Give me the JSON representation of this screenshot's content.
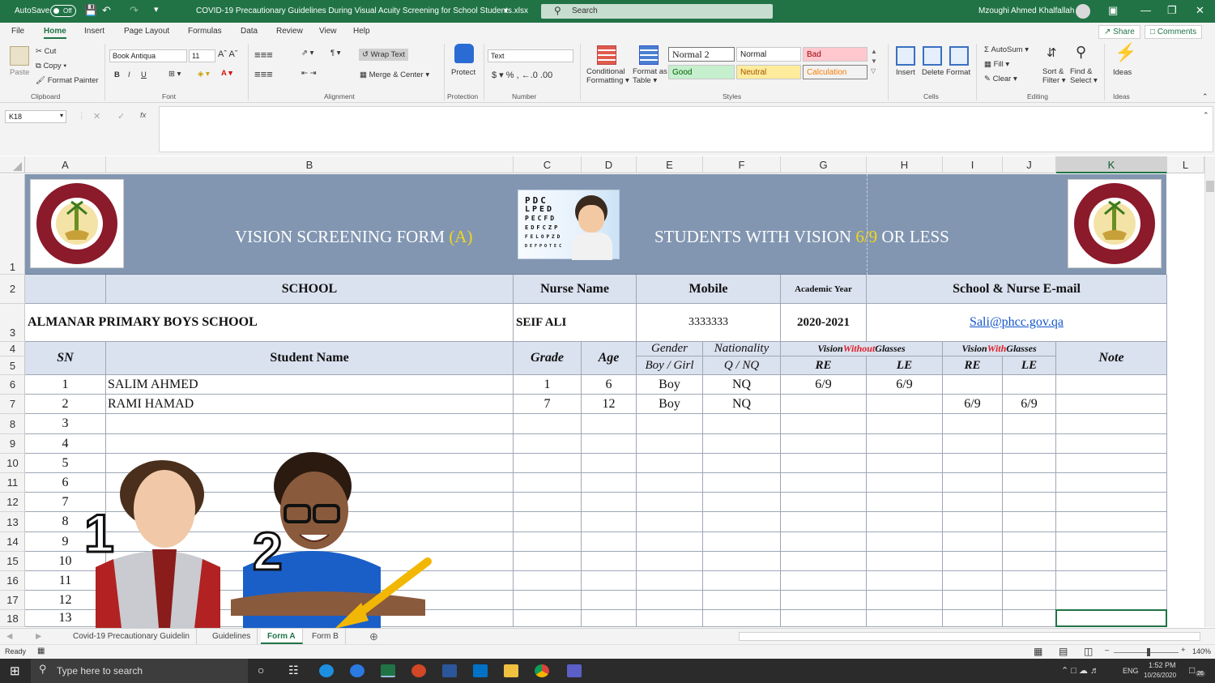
{
  "titlebar": {
    "autosave": "AutoSave",
    "autosave_state": "Off",
    "filename": "COVID-19 Precautionary Guidelines During Visual Acuity Screening for School Students.xlsx",
    "search": "Search",
    "user": "Mzoughi Ahmed Khalfallah"
  },
  "menu": {
    "file": "File",
    "home": "Home",
    "insert": "Insert",
    "page_layout": "Page Layout",
    "formulas": "Formulas",
    "data": "Data",
    "review": "Review",
    "view": "View",
    "help": "Help",
    "share": "Share",
    "comments": "Comments"
  },
  "ribbon": {
    "paste": "Paste",
    "cut": "Cut",
    "copy": "Copy",
    "format_painter": "Format Painter",
    "clipboard": "Clipboard",
    "font_name": "Book Antiqua",
    "font_size": "11",
    "bold": "B",
    "italic": "I",
    "underline": "U",
    "font": "Font",
    "wrap_text": "Wrap Text",
    "merge_center": "Merge & Center",
    "alignment": "Alignment",
    "protect": "Protect",
    "protection": "Protection",
    "number_format": "Text",
    "number": "Number",
    "conditional": "Conditional",
    "formatting": "Formatting",
    "format_as": "Format as",
    "table": "Table",
    "style_normal2": "Normal 2",
    "style_normal": "Normal",
    "style_bad": "Bad",
    "style_good": "Good",
    "style_neutral": "Neutral",
    "style_calculation": "Calculation",
    "styles": "Styles",
    "insert": "Insert",
    "delete": "Delete",
    "format": "Format",
    "cells": "Cells",
    "autosum": "AutoSum",
    "fill": "Fill",
    "clear": "Clear",
    "sort": "Sort &",
    "filter": "Filter",
    "find": "Find &",
    "select": "Select",
    "editing": "Editing",
    "ideas": "Ideas",
    "ideas_group": "Ideas"
  },
  "formula_bar": {
    "name_box": "K18",
    "fx": "fx"
  },
  "columns": [
    "A",
    "B",
    "C",
    "D",
    "E",
    "F",
    "G",
    "H",
    "I",
    "J",
    "K",
    "L"
  ],
  "rows": [
    "1",
    "2",
    "3",
    "4",
    "5",
    "6",
    "7",
    "8",
    "9",
    "10",
    "11",
    "12",
    "13",
    "14",
    "15",
    "16",
    "17",
    "18"
  ],
  "banner": {
    "title_left": "VISION SCREENING FORM ",
    "title_left_tag": "(A)",
    "title_right_1": "STUDENTS WITH VISION ",
    "title_right_ratio": "6/9",
    "title_right_2": " OR LESS",
    "eyechart_lines": [
      "PDC",
      "LPED",
      "PECFD",
      "EDFCZP",
      "FELOPZD",
      "DEFPOTEC"
    ]
  },
  "info": {
    "h_school": "SCHOOL",
    "h_nurse": "Nurse Name",
    "h_mobile": "Mobile",
    "h_year": "Academic Year",
    "h_email": "School & Nurse E-mail",
    "school_prefix": "ALMANAR",
    "school_rest": "PRIMARY BOYS SCHOOL",
    "nurse": "SEIF ALI",
    "mobile": "3333333",
    "year": "2020-2021",
    "email": "Sali@phcc.gov.qa"
  },
  "table_header": {
    "sn": "SN",
    "student": "Student Name",
    "grade": "Grade",
    "age": "Age",
    "gender": "Gender",
    "gender_sub": "Boy / Girl",
    "nationality": "Nationality",
    "nationality_sub": "Q  / NQ",
    "vwo_pre": "Vision ",
    "vwo_red": "Without",
    "vwo_post": " Glasses",
    "vw_pre": "Vision ",
    "vw_red": "With",
    "vw_post": " Glasses",
    "re": "RE",
    "le": "LE",
    "re2": "RE",
    "le2": "LE",
    "note": "Note"
  },
  "students": [
    {
      "sn": "1",
      "name": "SALIM AHMED",
      "grade": "1",
      "age": "6",
      "gender": "Boy",
      "nat": "NQ",
      "wo_re": "6/9",
      "wo_le": "6/9",
      "w_re": "",
      "w_le": ""
    },
    {
      "sn": "2",
      "name": "RAMI HAMAD",
      "grade": "7",
      "age": "12",
      "gender": "Boy",
      "nat": "NQ",
      "wo_re": "",
      "wo_le": "",
      "w_re": "6/9",
      "w_le": "6/9"
    },
    {
      "sn": "3"
    },
    {
      "sn": "4"
    },
    {
      "sn": "5"
    },
    {
      "sn": "6"
    },
    {
      "sn": "7"
    },
    {
      "sn": "8"
    },
    {
      "sn": "9"
    },
    {
      "sn": "10"
    },
    {
      "sn": "11"
    },
    {
      "sn": "12"
    },
    {
      "sn": "13"
    }
  ],
  "overlay_numbers": [
    "1",
    "2"
  ],
  "sheet_tabs": [
    "Covid-19 Precautionary Guidelin",
    "Guidelines",
    "Form A",
    "Form B"
  ],
  "active_tab": "Form A",
  "status": {
    "ready": "Ready",
    "zoom": "140%"
  },
  "taskbar": {
    "search": "Type here to search",
    "lang": "ENG",
    "time": "1:52 PM",
    "date": "10/26/2020",
    "badge": "26"
  },
  "colors": {
    "excel_green": "#217346",
    "banner_blue": "#8296b1",
    "header_fill": "#dae1ef",
    "highlight_yellow": "#f2d71c",
    "red_text": "#e0202a"
  }
}
